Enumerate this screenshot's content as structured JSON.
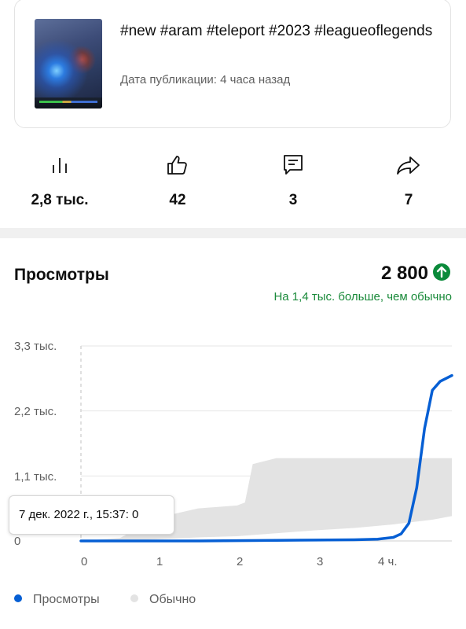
{
  "video": {
    "title": "#new #aram #teleport #2023 #leagueoflegends",
    "pub_date": "Дата публикации: 4 часа назад"
  },
  "stats": [
    {
      "icon": "bar-chart-icon",
      "value": "2,8 тыс."
    },
    {
      "icon": "thumbs-up-icon",
      "value": "42"
    },
    {
      "icon": "comment-icon",
      "value": "3"
    },
    {
      "icon": "share-icon",
      "value": "7"
    }
  ],
  "views": {
    "title": "Просмотры",
    "total": "2 800",
    "compare": "На 1,4 тыс. больше, чем обычно",
    "accent": "#1a8a3a"
  },
  "chart_data": {
    "type": "line",
    "x": [
      0,
      0.5,
      1,
      1.5,
      2,
      2.5,
      3,
      3.5,
      3.8,
      4,
      4.1,
      4.2,
      4.3,
      4.4,
      4.5,
      4.6,
      4.75
    ],
    "series": [
      {
        "name": "Просмотры",
        "color": "#065fd4",
        "values": [
          0,
          0,
          0,
          0,
          5,
          10,
          15,
          20,
          30,
          60,
          120,
          300,
          900,
          1900,
          2550,
          2700,
          2800
        ]
      }
    ],
    "typical_band": {
      "name": "Обычно",
      "color": "#e3e3e3",
      "x": [
        0,
        0.5,
        1,
        1.5,
        2,
        2.1,
        2.2,
        2.5,
        3,
        3.5,
        4,
        4.5,
        4.75
      ],
      "upper": [
        0,
        50,
        400,
        550,
        600,
        650,
        1300,
        1400,
        1400,
        1400,
        1400,
        1400,
        1400
      ],
      "lower": [
        0,
        0,
        30,
        60,
        80,
        90,
        100,
        130,
        180,
        220,
        280,
        360,
        420
      ]
    },
    "y_ticks": [
      "0",
      "1,1 тыс.",
      "2,2 тыс.",
      "3,3 тыс."
    ],
    "x_ticks": [
      "0",
      "1",
      "2",
      "3",
      "4 ч."
    ],
    "xlim": [
      0,
      4.75
    ],
    "ylim": [
      0,
      3300
    ],
    "tooltip": "7 дек. 2022 г., 15:37: 0"
  },
  "legend": [
    {
      "label": "Просмотры",
      "color": "#065fd4"
    },
    {
      "label": "Обычно",
      "color": "#e3e3e3"
    }
  ]
}
